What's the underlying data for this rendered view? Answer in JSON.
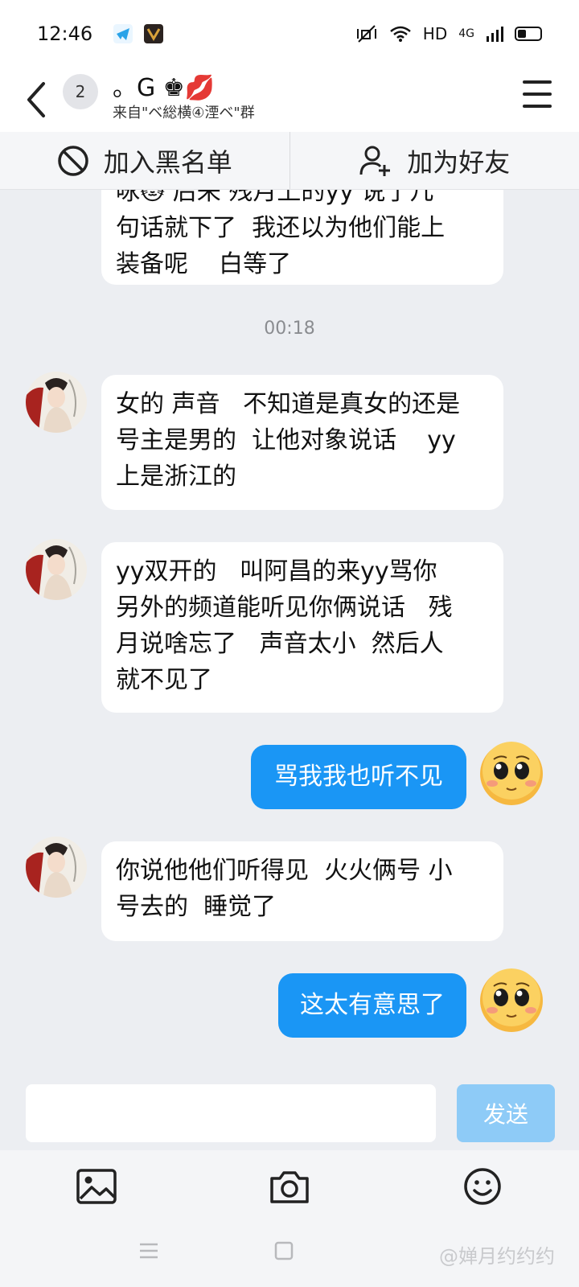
{
  "status": {
    "time": "12:46",
    "network": "HD",
    "signal": "4G"
  },
  "header": {
    "unread_count": "2",
    "name": "。G ♚💋",
    "subtitle": "来自\"ベ総横④湮ベ\"群"
  },
  "actions": {
    "block": "加入黑名单",
    "add_friend": "加为好友"
  },
  "chat": {
    "partial_message": "咏🐱 后来 残月上的yy 说了几\n句话就下了  我还以为他们能上\n装备呢    白等了",
    "timestamp": "00:18",
    "messages": [
      {
        "text": "女的 声音   不知道是真女的还是\n号主是男的  让他对象说话    yy\n上是浙江的"
      },
      {
        "text": "yy双开的   叫阿昌的来yy骂你\n另外的频道能听见你俩说话   残\n月说啥忘了   声音太小  然后人\n就不见了"
      },
      {
        "text": "骂我我也听不见"
      },
      {
        "text": "你说他他们听得见  火火俩号 小\n号去的  睡觉了"
      },
      {
        "text": "这太有意思了"
      }
    ]
  },
  "composer": {
    "placeholder": "",
    "send_label": "发送"
  },
  "watermark": "@婵月约约约",
  "colors": {
    "accent": "#1a96f5",
    "send_disabled": "#8ecbf7",
    "background": "#eceef2"
  }
}
